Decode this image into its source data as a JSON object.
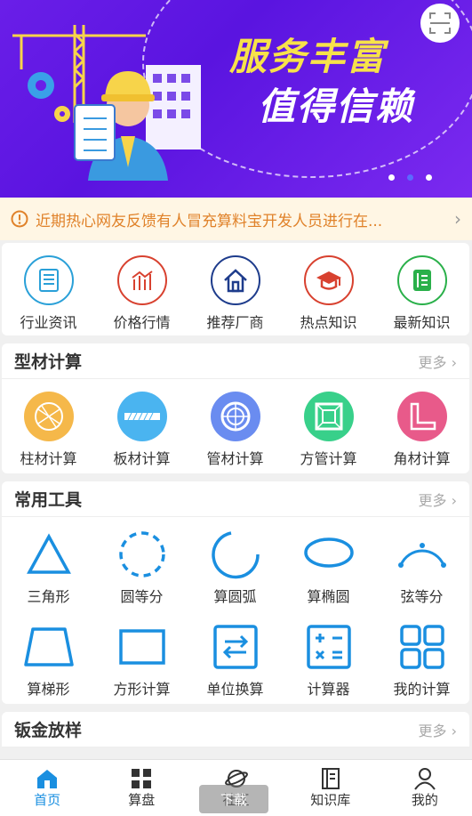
{
  "banner": {
    "title_line1": "服务丰富",
    "title_line2": "值得信赖",
    "dots": 3,
    "active_dot": 1
  },
  "notice": {
    "text": "近期热心网友反馈有人冒充算料宝开发人员进行在..."
  },
  "categories": [
    {
      "label": "行业资讯",
      "icon": "news-icon",
      "color": "#2aa0d8"
    },
    {
      "label": "价格行情",
      "icon": "chart-icon",
      "color": "#d8412f"
    },
    {
      "label": "推荐厂商",
      "icon": "house-icon",
      "color": "#1e3c8c"
    },
    {
      "label": "热点知识",
      "icon": "graduation-cap-icon",
      "color": "#d8412f"
    },
    {
      "label": "最新知识",
      "icon": "book-icon",
      "color": "#2ab04a"
    }
  ],
  "profile_section": {
    "title": "型材计算",
    "more": "更多",
    "items": [
      {
        "label": "柱材计算",
        "icon": "column-material-icon"
      },
      {
        "label": "板材计算",
        "icon": "plate-material-icon"
      },
      {
        "label": "管材计算",
        "icon": "pipe-material-icon"
      },
      {
        "label": "方管计算",
        "icon": "square-tube-icon"
      },
      {
        "label": "角材计算",
        "icon": "angle-material-icon"
      }
    ]
  },
  "tools_section": {
    "title": "常用工具",
    "more": "更多",
    "row1": [
      {
        "label": "三角形",
        "icon": "triangle-icon"
      },
      {
        "label": "圆等分",
        "icon": "circle-divide-icon"
      },
      {
        "label": "算圆弧",
        "icon": "arc-icon"
      },
      {
        "label": "算椭圆",
        "icon": "ellipse-icon"
      },
      {
        "label": "弦等分",
        "icon": "chord-divide-icon"
      }
    ],
    "row2": [
      {
        "label": "算梯形",
        "icon": "trapezoid-icon"
      },
      {
        "label": "方形计算",
        "icon": "rectangle-icon"
      },
      {
        "label": "单位换算",
        "icon": "unit-convert-icon"
      },
      {
        "label": "计算器",
        "icon": "calculator-icon"
      },
      {
        "label": "我的计算",
        "icon": "my-calc-icon"
      }
    ]
  },
  "sheet_section": {
    "title": "钣金放样",
    "more": "更多"
  },
  "tabbar": [
    {
      "label": "首页",
      "icon": "home-icon",
      "active": true
    },
    {
      "label": "算盘",
      "icon": "grid-icon",
      "active": false
    },
    {
      "label": "社区",
      "icon": "planet-icon",
      "active": false
    },
    {
      "label": "知识库",
      "icon": "knowledge-icon",
      "active": false
    },
    {
      "label": "我的",
      "icon": "user-icon",
      "active": false
    }
  ],
  "watermark": "下载",
  "colors": {
    "primary_blue": "#1a8fe0",
    "banner_purple": "#6a1ee8",
    "notice_orange": "#e0822a"
  }
}
